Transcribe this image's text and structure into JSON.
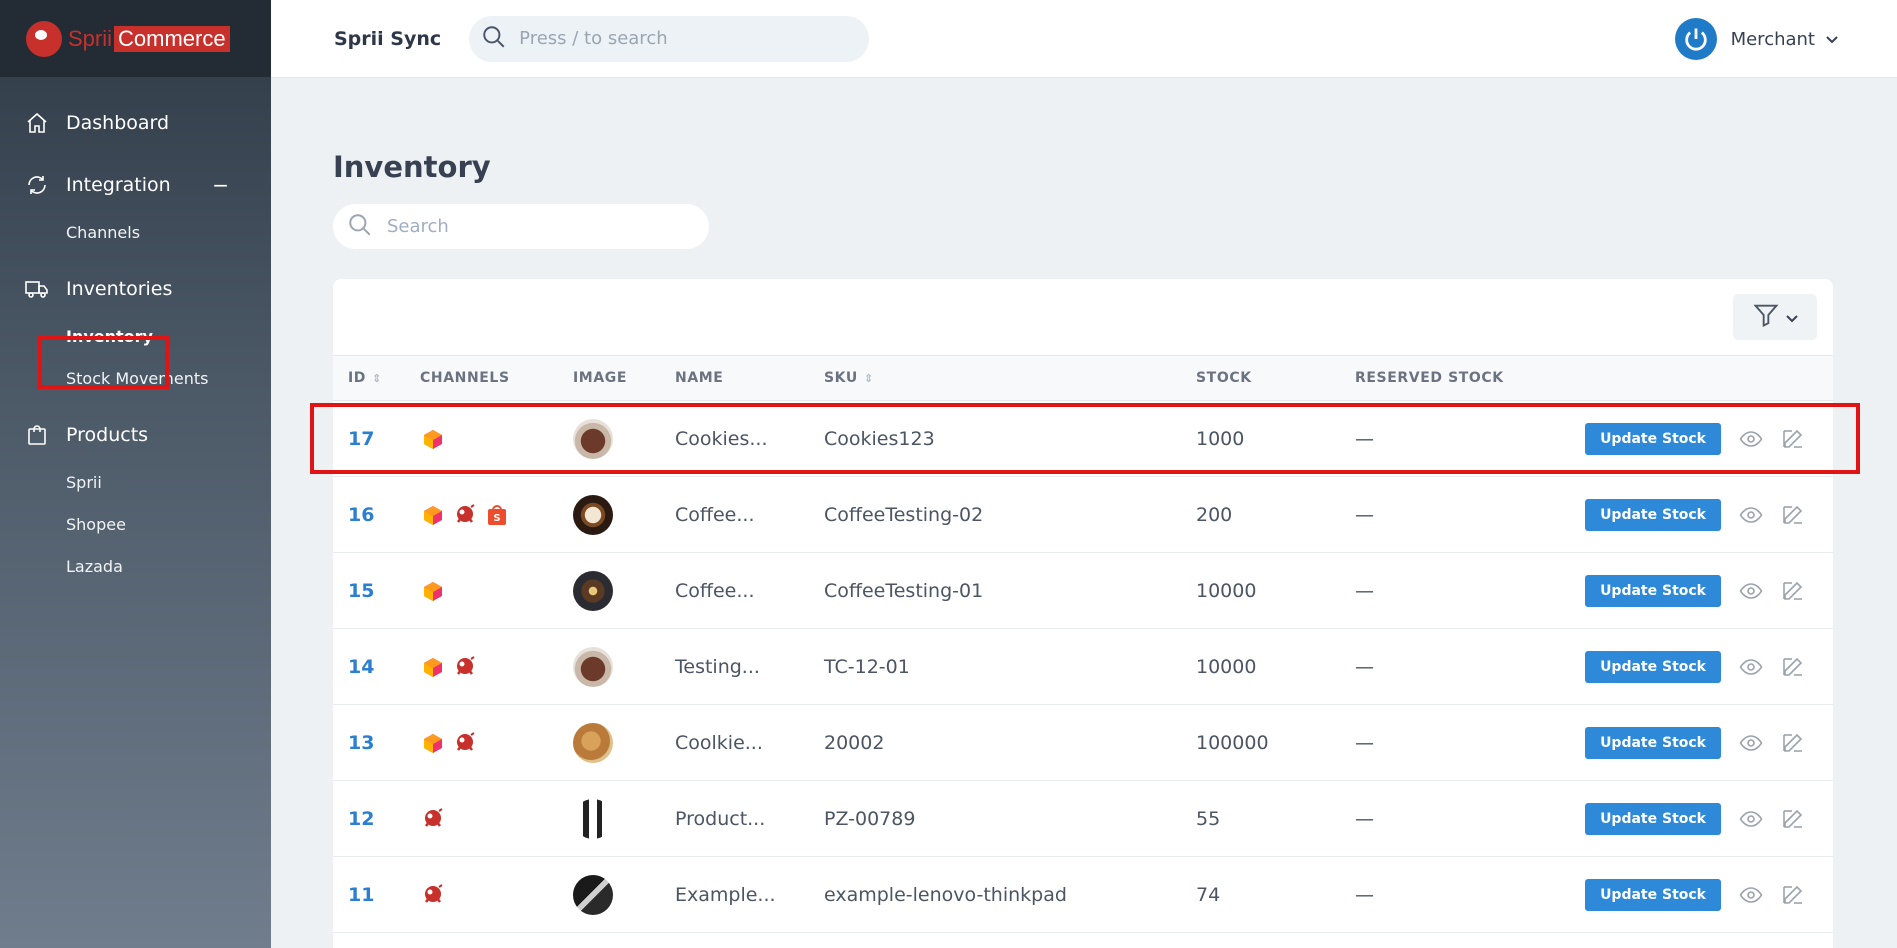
{
  "brand": {
    "part1": "Sprii",
    "part2": "Commerce"
  },
  "topbar": {
    "app_name": "Sprii Sync",
    "search_placeholder": "Press / to search",
    "user_name": "Merchant"
  },
  "sidebar": {
    "dashboard": "Dashboard",
    "integration": "Integration",
    "integration_toggle": "−",
    "channels": "Channels",
    "inventories": "Inventories",
    "inventory": "Inventory",
    "stock_movements": "Stock Movements",
    "products": "Products",
    "sprii": "Sprii",
    "shopee": "Shopee",
    "lazada": "Lazada"
  },
  "main": {
    "title": "Inventory",
    "search_placeholder": "Search",
    "columns": {
      "id": "ID",
      "channels": "CHANNELS",
      "image": "IMAGE",
      "name": "NAME",
      "sku": "SKU",
      "stock": "STOCK",
      "reserved": "RESERVED STOCK"
    },
    "update_label": "Update Stock",
    "rows": [
      {
        "id": "17",
        "channels": [
          "lazada"
        ],
        "image": "cookies-jar",
        "name": "Cookies...",
        "sku": "Cookies123",
        "stock": "1000",
        "reserved": "—"
      },
      {
        "id": "16",
        "channels": [
          "lazada",
          "sprii",
          "shopee"
        ],
        "image": "coffee-cup",
        "name": "Coffee...",
        "sku": "CoffeeTesting-02",
        "stock": "200",
        "reserved": "—"
      },
      {
        "id": "15",
        "channels": [
          "lazada"
        ],
        "image": "coffee-beans",
        "name": "Coffee...",
        "sku": "CoffeeTesting-01",
        "stock": "10000",
        "reserved": "—"
      },
      {
        "id": "14",
        "channels": [
          "lazada",
          "sprii"
        ],
        "image": "cookies-jar",
        "name": "Testing...",
        "sku": "TC-12-01",
        "stock": "10000",
        "reserved": "—"
      },
      {
        "id": "13",
        "channels": [
          "lazada",
          "sprii"
        ],
        "image": "cookies-plate",
        "name": "Coolkie...",
        "sku": "20002",
        "stock": "100000",
        "reserved": "—"
      },
      {
        "id": "12",
        "channels": [
          "sprii"
        ],
        "image": "watch",
        "name": "Product...",
        "sku": "PZ-00789",
        "stock": "55",
        "reserved": "—"
      },
      {
        "id": "11",
        "channels": [
          "sprii"
        ],
        "image": "laptop",
        "name": "Example...",
        "sku": "example-lenovo-thinkpad",
        "stock": "74",
        "reserved": "—"
      }
    ]
  },
  "colors": {
    "accent": "#2e8ad8",
    "highlight": "#e01414",
    "brand_red": "#c8302b"
  }
}
